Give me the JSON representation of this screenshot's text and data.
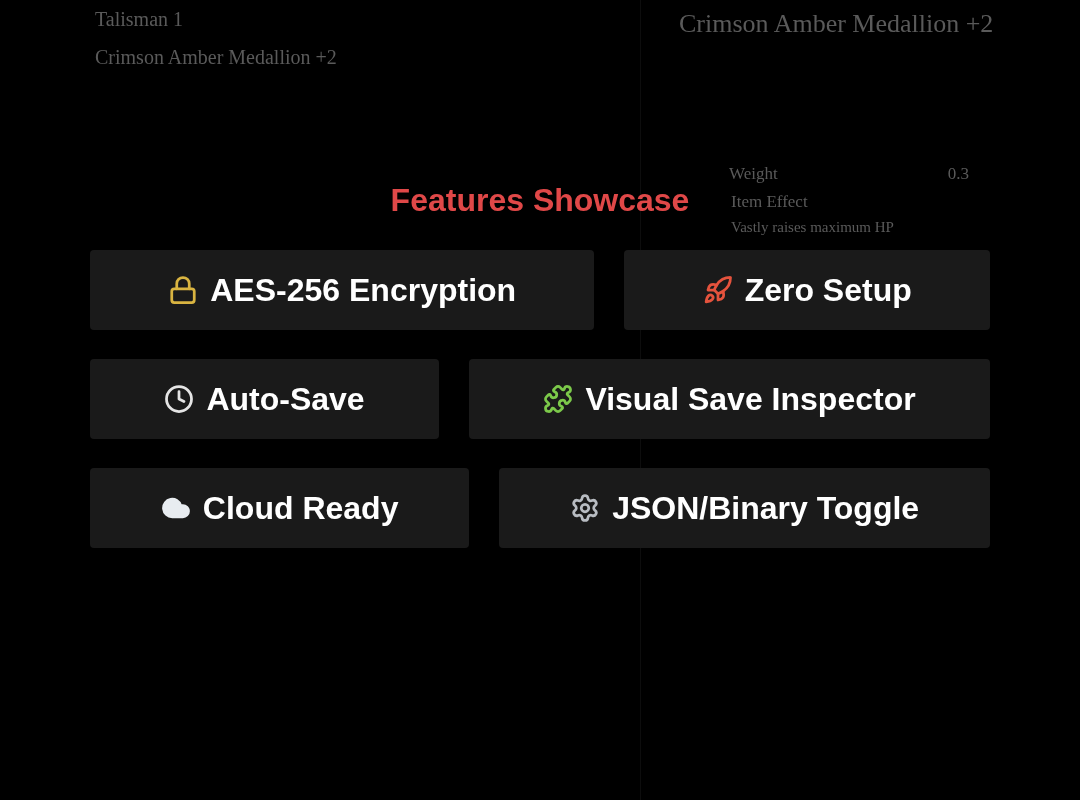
{
  "background": {
    "slot_label": "Talisman 1",
    "item_name": "Crimson Amber Medallion +2",
    "detail_title": "Crimson Amber Medallion +2",
    "stats": [
      {
        "label": "Weight",
        "value": "0.3"
      }
    ],
    "effect_heading": "Item Effect",
    "effect_text": "Vastly raises maximum HP"
  },
  "title": "Features Showcase",
  "rows": [
    [
      {
        "kind": "lock",
        "label": "AES-256 Encryption"
      },
      {
        "kind": "rocket",
        "label": "Zero Setup"
      }
    ],
    [
      {
        "kind": "clock",
        "label": "Auto-Save"
      },
      {
        "kind": "puzzle",
        "label": "Visual Save Inspector"
      }
    ],
    [
      {
        "kind": "cloud",
        "label": "Cloud Ready"
      },
      {
        "kind": "gear",
        "label": "JSON/Binary Toggle"
      }
    ]
  ]
}
